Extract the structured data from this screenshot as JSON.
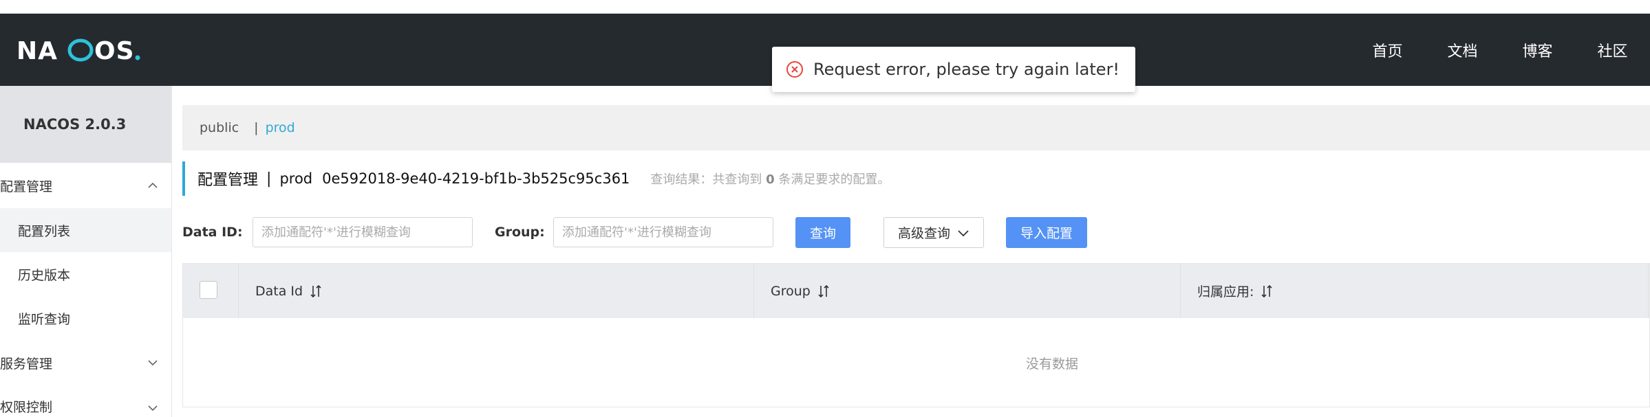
{
  "header": {
    "logo_text": "NACOS.",
    "nav": [
      "首页",
      "文档",
      "博客",
      "社区"
    ]
  },
  "sidebar": {
    "version": "NACOS 2.0.3",
    "groups": [
      {
        "label": "配置管理",
        "expanded": true,
        "items": [
          "配置列表",
          "历史版本",
          "监听查询"
        ],
        "active_item": "配置列表"
      },
      {
        "label": "服务管理",
        "expanded": false
      },
      {
        "label": "权限控制",
        "expanded": false
      }
    ]
  },
  "namespaces": {
    "items": [
      "public",
      "prod"
    ],
    "separator": "|",
    "active": "prod"
  },
  "title": {
    "main": "配置管理",
    "separator": "|",
    "namespace": "prod",
    "namespace_id": "0e592018-9e40-4219-bf1b-3b525c95c361",
    "result_prefix": "查询结果：共查询到",
    "result_count": "0",
    "result_suffix": "条满足要求的配置。"
  },
  "filters": {
    "data_id_label": "Data ID:",
    "data_id_placeholder": "添加通配符'*'进行模糊查询",
    "group_label": "Group:",
    "group_placeholder": "添加通配符'*'进行模糊查询",
    "search_button": "查询",
    "advanced_button": "高级查询",
    "import_button": "导入配置"
  },
  "table": {
    "columns": [
      "Data Id",
      "Group",
      "归属应用:"
    ],
    "empty_text": "没有数据"
  },
  "toast": {
    "message": "Request error, please try again later!",
    "type": "error",
    "color": "#e8453c"
  },
  "colors": {
    "header_bg": "#252a2f",
    "accent": "#2fa8d5",
    "primary_button": "#5592f5"
  }
}
